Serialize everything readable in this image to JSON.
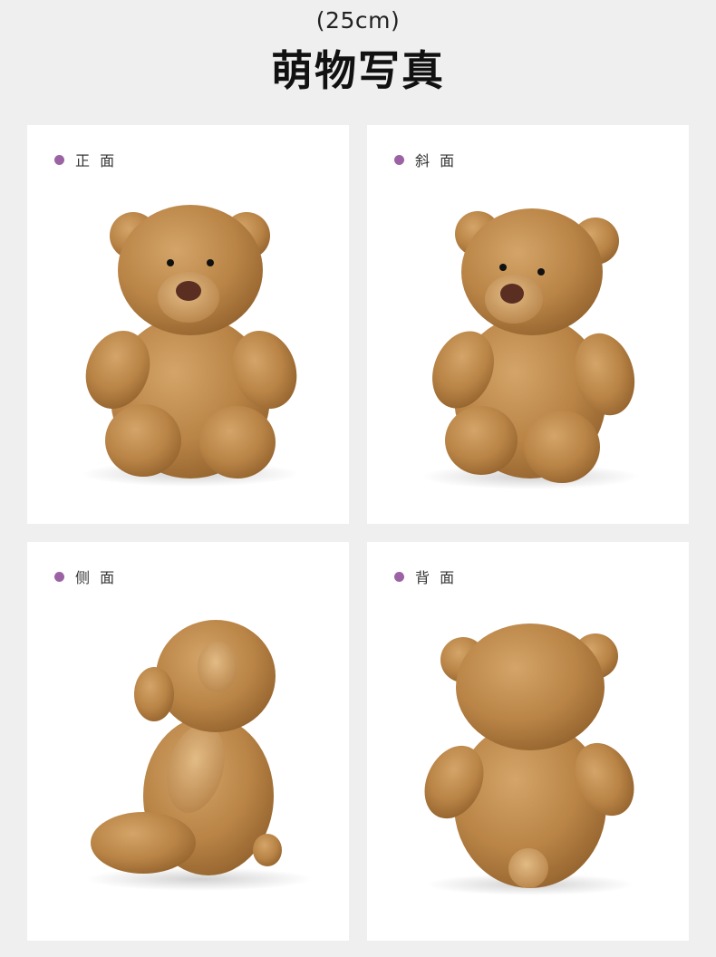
{
  "header": {
    "size": "(25cm)",
    "title": "萌物写真"
  },
  "cards": [
    {
      "label": "正 面",
      "view": "front"
    },
    {
      "label": "斜 面",
      "view": "angled"
    },
    {
      "label": "侧 面",
      "view": "side"
    },
    {
      "label": "背 面",
      "view": "back"
    }
  ],
  "colors": {
    "page_bg": "#efefef",
    "card_bg": "#ffffff",
    "dot": "#9b63a3",
    "fur": "#b98446"
  }
}
